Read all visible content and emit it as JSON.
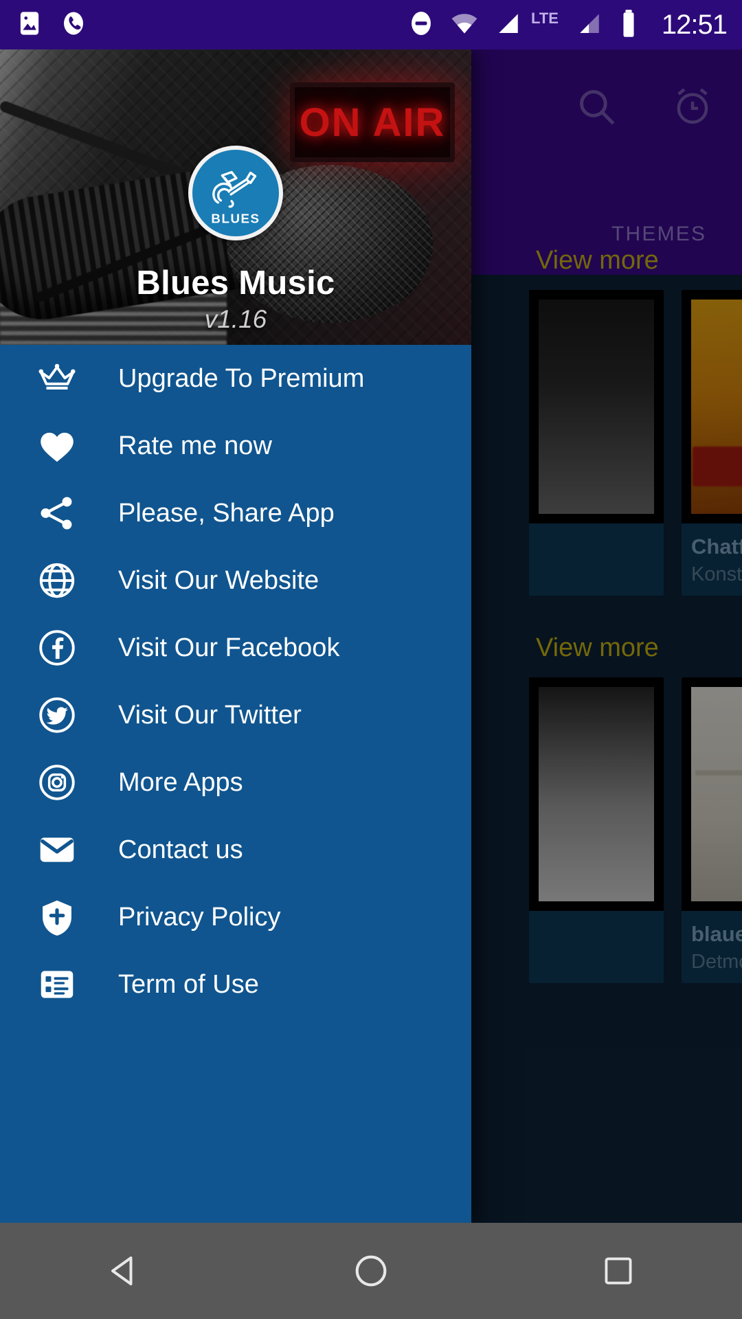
{
  "status_bar": {
    "time": "12:51",
    "network_label": "LTE",
    "left_icons": [
      "image-icon",
      "phone-call-icon"
    ],
    "right_icons": [
      "do-not-disturb-icon",
      "wifi-icon",
      "signal-icon",
      "signal-2-icon",
      "battery-icon"
    ]
  },
  "background_app": {
    "actions": [
      {
        "name": "search-icon",
        "label": "Search"
      },
      {
        "name": "alarm-clock-icon",
        "label": "Sleep timer"
      }
    ],
    "tabs": [
      {
        "label": "THEMES",
        "selected": false
      }
    ],
    "sections": [
      {
        "view_more_label": "View more"
      },
      {
        "view_more_label": "View more"
      }
    ],
    "cards": [
      {
        "title": "",
        "subtitle": "",
        "thumb": "th-a"
      },
      {
        "title": "Chatfire",
        "subtitle": "Konstanz",
        "thumb": "th-b"
      },
      {
        "title": "",
        "subtitle": "",
        "thumb": "th-c"
      },
      {
        "title": "blauera",
        "subtitle": "Detmold",
        "thumb": "th-d"
      }
    ]
  },
  "drawer": {
    "app_name": "Blues Music",
    "version": "v1.16",
    "logo": {
      "name": "blues-guitar-logo",
      "text": "BLUES",
      "bg_color": "#1a7db5"
    },
    "on_air_sign": "ON AIR",
    "items": [
      {
        "label": "Upgrade To Premium",
        "icon": "crown-icon",
        "key": "upgrade-to-premium"
      },
      {
        "label": "Rate me now",
        "icon": "heart-icon",
        "key": "rate-me-now"
      },
      {
        "label": "Please, Share App",
        "icon": "share-icon",
        "key": "share-app"
      },
      {
        "label": "Visit Our Website",
        "icon": "globe-icon",
        "key": "visit-website"
      },
      {
        "label": "Visit Our Facebook",
        "icon": "facebook-icon",
        "key": "visit-facebook"
      },
      {
        "label": "Visit Our Twitter",
        "icon": "twitter-icon",
        "key": "visit-twitter"
      },
      {
        "label": "More Apps",
        "icon": "instagram-icon",
        "key": "more-apps"
      },
      {
        "label": "Contact us",
        "icon": "envelope-icon",
        "key": "contact-us"
      },
      {
        "label": "Privacy Policy",
        "icon": "shield-icon",
        "key": "privacy-policy"
      },
      {
        "label": "Term of Use",
        "icon": "list-document-icon",
        "key": "term-of-use"
      }
    ]
  },
  "nav_bar": {
    "buttons": [
      {
        "name": "back-button",
        "label": "Back"
      },
      {
        "name": "home-button",
        "label": "Home"
      },
      {
        "name": "recents-button",
        "label": "Recents"
      }
    ]
  },
  "colors": {
    "status_bar": "#2d0a7a",
    "app_bar": "#3a0a8c",
    "drawer": "#10558f",
    "content_bg": "#0d2236",
    "accent_gold": "#c8b312",
    "nav_bar": "#585858"
  }
}
